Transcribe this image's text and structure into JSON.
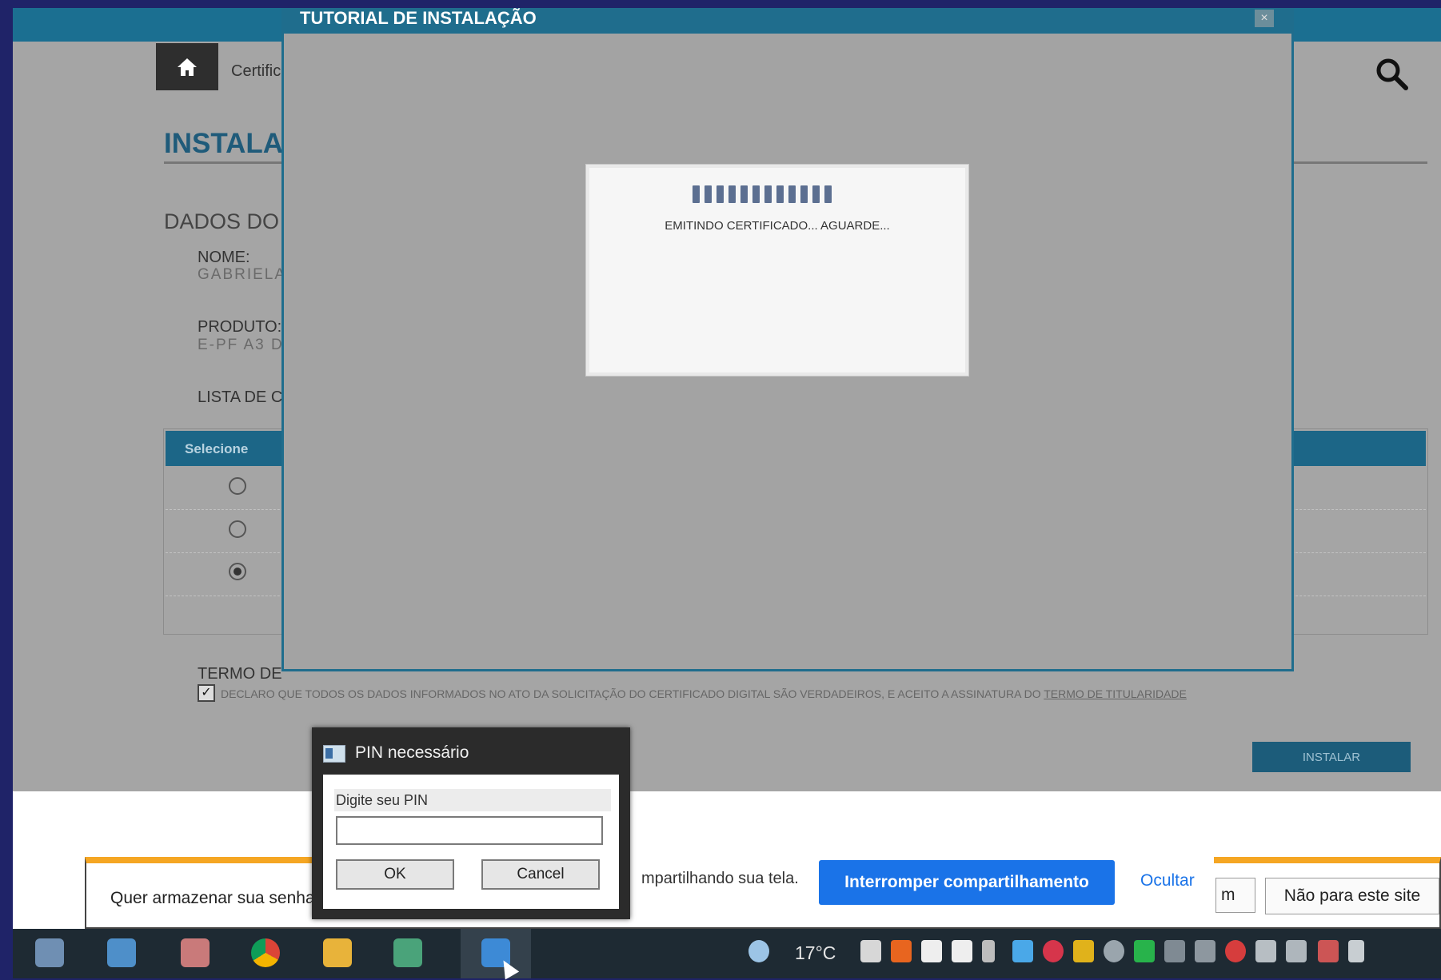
{
  "page": {
    "breadcrumb": "Certific",
    "title": "INSTALA",
    "section_title": "DADOS DO",
    "name_label": "NOME:",
    "name_value": "GABRIELA",
    "product_label": "PRODUTO:",
    "product_value": "E-PF A3 D",
    "list_label": "LISTA DE C",
    "table_header": "Selecione",
    "table_rows": [
      {
        "selected": false
      },
      {
        "selected": false
      },
      {
        "selected": true
      }
    ],
    "terms_title": "TERMO DE",
    "terms_text": "DECLARO QUE TODOS OS DADOS INFORMADOS NO ATO DA SOLICITAÇÃO DO CERTIFICADO DIGITAL SÃO VERDADEIROS, E ACEITO A ASSINATURA DO ",
    "terms_link": "TERMO DE TITULARIDADE",
    "terms_checked": true,
    "install_button": "INSTALAR"
  },
  "modal": {
    "title": "TUTORIAL DE INSTALAÇÃO",
    "close_glyph": "×",
    "progress_text": "EMITINDO CERTIFICADO... AGUARDE...",
    "progress_segments": 12
  },
  "pin_dialog": {
    "title": "PIN necessário",
    "label": "Digite seu PIN",
    "input_value": "",
    "ok_label": "OK",
    "cancel_label": "Cancel"
  },
  "password_bar": {
    "prompt": "Quer armazenar sua senha",
    "save_label_partial": "m",
    "never_label": "Não para este site"
  },
  "share_bar": {
    "text_partial": "mpartilhando sua tela.",
    "stop_label": "Interromper compartilhamento",
    "hide_label": "Ocultar"
  },
  "taskbar": {
    "temperature": "17°C",
    "apps": [
      "paint-icon",
      "notepad-icon",
      "palette-icon",
      "chrome-icon",
      "file-explorer-icon",
      "app-icon",
      "certificate-app-icon"
    ],
    "tray": [
      "cloud-icon",
      "drive-icon",
      "b-app-icon",
      "v-app-icon",
      "v2-app-icon",
      "mic-icon",
      "photos-icon",
      "sync-icon",
      "grid-icon",
      "webcam-icon",
      "shield-icon",
      "mute-icon",
      "wifi-icon",
      "user-icon",
      "chat-icon",
      "volume-icon",
      "gun-icon",
      "network-icon"
    ]
  },
  "colors": {
    "accent": "#1f6d8d",
    "share_button": "#1a73e8",
    "warning_bar": "#f5a623"
  }
}
